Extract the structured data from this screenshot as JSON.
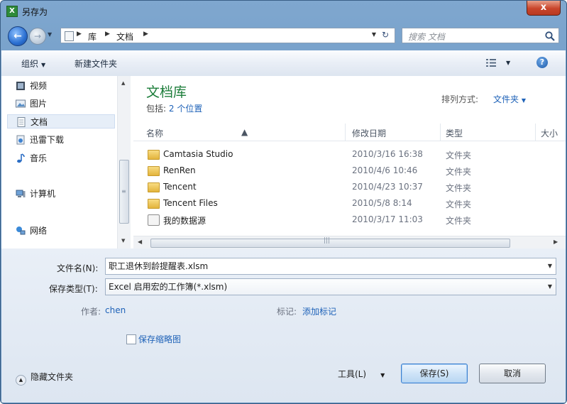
{
  "window": {
    "title": "另存为",
    "close_label": "x"
  },
  "nav": {
    "back_label": "←",
    "forward_label": "→",
    "breadcrumb": [
      "库",
      "文档"
    ],
    "refresh_label": "↻",
    "search_placeholder": "搜索 文档"
  },
  "toolbar": {
    "organize": "组织",
    "new_folder": "新建文件夹",
    "help": "?"
  },
  "sidebar": {
    "items": [
      {
        "label": "视频",
        "icon": "video-icon"
      },
      {
        "label": "图片",
        "icon": "picture-icon"
      },
      {
        "label": "文档",
        "icon": "document-icon",
        "selected": true
      },
      {
        "label": "迅雷下载",
        "icon": "download-icon"
      },
      {
        "label": "音乐",
        "icon": "music-icon"
      },
      {
        "label": "计算机",
        "icon": "computer-icon"
      },
      {
        "label": "网络",
        "icon": "network-icon"
      }
    ]
  },
  "library": {
    "title": "文档库",
    "includes_label": "包括:",
    "includes_link": "2 个位置",
    "sort_label": "排列方式:",
    "sort_value": "文件夹"
  },
  "columns": {
    "name": "名称",
    "modified": "修改日期",
    "type": "类型",
    "size": "大小"
  },
  "files": [
    {
      "name": "Camtasia Studio",
      "modified": "2010/3/16 16:38",
      "type": "文件夹",
      "icon": "folder-icon"
    },
    {
      "name": "RenRen",
      "modified": "2010/4/6 10:46",
      "type": "文件夹",
      "icon": "folder-icon"
    },
    {
      "name": "Tencent",
      "modified": "2010/4/23 10:37",
      "type": "文件夹",
      "icon": "folder-icon"
    },
    {
      "name": "Tencent Files",
      "modified": "2010/5/8 8:14",
      "type": "文件夹",
      "icon": "folder-icon"
    },
    {
      "name": "我的数据源",
      "modified": "2010/3/17 11:03",
      "type": "文件夹",
      "icon": "database-folder-icon"
    }
  ],
  "form": {
    "filename_label": "文件名(N):",
    "filename_value": "职工退休到龄提醒表.xlsm",
    "filetype_label": "保存类型(T):",
    "filetype_value": "Excel 启用宏的工作簿(*.xlsm)",
    "author_label": "作者:",
    "author_value": "chen",
    "tags_label": "标记:",
    "tags_value": "添加标记",
    "thumbnail_label": "保存缩略图"
  },
  "footer": {
    "hide_folders": "隐藏文件夹",
    "tools": "工具(L)",
    "save": "保存(S)",
    "cancel": "取消"
  }
}
